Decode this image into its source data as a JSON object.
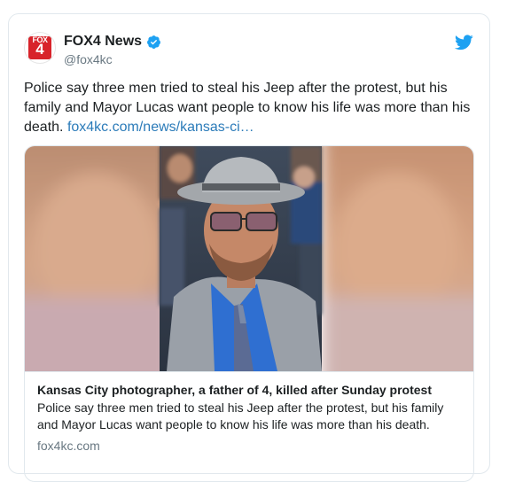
{
  "author": {
    "display_name": "FOX4 News",
    "handle": "@fox4kc",
    "avatar_text_top": "FOX",
    "avatar_text_main": "4",
    "verified": true
  },
  "tweet": {
    "text": "Police say three men tried to steal his Jeep after the protest, but his family and Mayor Lucas want people to know his life was more than his death.",
    "link_text": "fox4kc.com/news/kansas-ci…"
  },
  "card": {
    "title": "Kansas City photographer, a father of 4, killed after Sunday protest",
    "description": "Police say three men tried to steal his Jeep after the protest, but his family and Mayor Lucas want people to know his life was more than his death.",
    "domain": "fox4kc.com"
  },
  "colors": {
    "link": "#2b7bb9",
    "twitter_blue": "#1da1f2",
    "fox_red": "#d8232a",
    "secondary_text": "#697882",
    "border": "#e1e8ed"
  },
  "icons": {
    "verified": "verified-badge-icon",
    "brand": "twitter-bird-icon"
  }
}
